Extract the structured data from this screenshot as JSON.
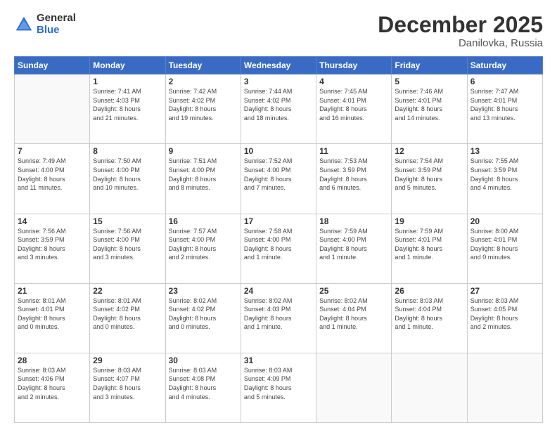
{
  "header": {
    "logo_general": "General",
    "logo_blue": "Blue",
    "month_title": "December 2025",
    "location": "Danilovka, Russia"
  },
  "days_of_week": [
    "Sunday",
    "Monday",
    "Tuesday",
    "Wednesday",
    "Thursday",
    "Friday",
    "Saturday"
  ],
  "weeks": [
    [
      {
        "day": "",
        "info": ""
      },
      {
        "day": "1",
        "info": "Sunrise: 7:41 AM\nSunset: 4:03 PM\nDaylight: 8 hours\nand 21 minutes."
      },
      {
        "day": "2",
        "info": "Sunrise: 7:42 AM\nSunset: 4:02 PM\nDaylight: 8 hours\nand 19 minutes."
      },
      {
        "day": "3",
        "info": "Sunrise: 7:44 AM\nSunset: 4:02 PM\nDaylight: 8 hours\nand 18 minutes."
      },
      {
        "day": "4",
        "info": "Sunrise: 7:45 AM\nSunset: 4:01 PM\nDaylight: 8 hours\nand 16 minutes."
      },
      {
        "day": "5",
        "info": "Sunrise: 7:46 AM\nSunset: 4:01 PM\nDaylight: 8 hours\nand 14 minutes."
      },
      {
        "day": "6",
        "info": "Sunrise: 7:47 AM\nSunset: 4:01 PM\nDaylight: 8 hours\nand 13 minutes."
      }
    ],
    [
      {
        "day": "7",
        "info": "Sunrise: 7:49 AM\nSunset: 4:00 PM\nDaylight: 8 hours\nand 11 minutes."
      },
      {
        "day": "8",
        "info": "Sunrise: 7:50 AM\nSunset: 4:00 PM\nDaylight: 8 hours\nand 10 minutes."
      },
      {
        "day": "9",
        "info": "Sunrise: 7:51 AM\nSunset: 4:00 PM\nDaylight: 8 hours\nand 8 minutes."
      },
      {
        "day": "10",
        "info": "Sunrise: 7:52 AM\nSunset: 4:00 PM\nDaylight: 8 hours\nand 7 minutes."
      },
      {
        "day": "11",
        "info": "Sunrise: 7:53 AM\nSunset: 3:59 PM\nDaylight: 8 hours\nand 6 minutes."
      },
      {
        "day": "12",
        "info": "Sunrise: 7:54 AM\nSunset: 3:59 PM\nDaylight: 8 hours\nand 5 minutes."
      },
      {
        "day": "13",
        "info": "Sunrise: 7:55 AM\nSunset: 3:59 PM\nDaylight: 8 hours\nand 4 minutes."
      }
    ],
    [
      {
        "day": "14",
        "info": "Sunrise: 7:56 AM\nSunset: 3:59 PM\nDaylight: 8 hours\nand 3 minutes."
      },
      {
        "day": "15",
        "info": "Sunrise: 7:56 AM\nSunset: 4:00 PM\nDaylight: 8 hours\nand 3 minutes."
      },
      {
        "day": "16",
        "info": "Sunrise: 7:57 AM\nSunset: 4:00 PM\nDaylight: 8 hours\nand 2 minutes."
      },
      {
        "day": "17",
        "info": "Sunrise: 7:58 AM\nSunset: 4:00 PM\nDaylight: 8 hours\nand 1 minute."
      },
      {
        "day": "18",
        "info": "Sunrise: 7:59 AM\nSunset: 4:00 PM\nDaylight: 8 hours\nand 1 minute."
      },
      {
        "day": "19",
        "info": "Sunrise: 7:59 AM\nSunset: 4:01 PM\nDaylight: 8 hours\nand 1 minute."
      },
      {
        "day": "20",
        "info": "Sunrise: 8:00 AM\nSunset: 4:01 PM\nDaylight: 8 hours\nand 0 minutes."
      }
    ],
    [
      {
        "day": "21",
        "info": "Sunrise: 8:01 AM\nSunset: 4:01 PM\nDaylight: 8 hours\nand 0 minutes."
      },
      {
        "day": "22",
        "info": "Sunrise: 8:01 AM\nSunset: 4:02 PM\nDaylight: 8 hours\nand 0 minutes."
      },
      {
        "day": "23",
        "info": "Sunrise: 8:02 AM\nSunset: 4:02 PM\nDaylight: 8 hours\nand 0 minutes."
      },
      {
        "day": "24",
        "info": "Sunrise: 8:02 AM\nSunset: 4:03 PM\nDaylight: 8 hours\nand 1 minute."
      },
      {
        "day": "25",
        "info": "Sunrise: 8:02 AM\nSunset: 4:04 PM\nDaylight: 8 hours\nand 1 minute."
      },
      {
        "day": "26",
        "info": "Sunrise: 8:03 AM\nSunset: 4:04 PM\nDaylight: 8 hours\nand 1 minute."
      },
      {
        "day": "27",
        "info": "Sunrise: 8:03 AM\nSunset: 4:05 PM\nDaylight: 8 hours\nand 2 minutes."
      }
    ],
    [
      {
        "day": "28",
        "info": "Sunrise: 8:03 AM\nSunset: 4:06 PM\nDaylight: 8 hours\nand 2 minutes."
      },
      {
        "day": "29",
        "info": "Sunrise: 8:03 AM\nSunset: 4:07 PM\nDaylight: 8 hours\nand 3 minutes."
      },
      {
        "day": "30",
        "info": "Sunrise: 8:03 AM\nSunset: 4:08 PM\nDaylight: 8 hours\nand 4 minutes."
      },
      {
        "day": "31",
        "info": "Sunrise: 8:03 AM\nSunset: 4:09 PM\nDaylight: 8 hours\nand 5 minutes."
      },
      {
        "day": "",
        "info": ""
      },
      {
        "day": "",
        "info": ""
      },
      {
        "day": "",
        "info": ""
      }
    ]
  ]
}
